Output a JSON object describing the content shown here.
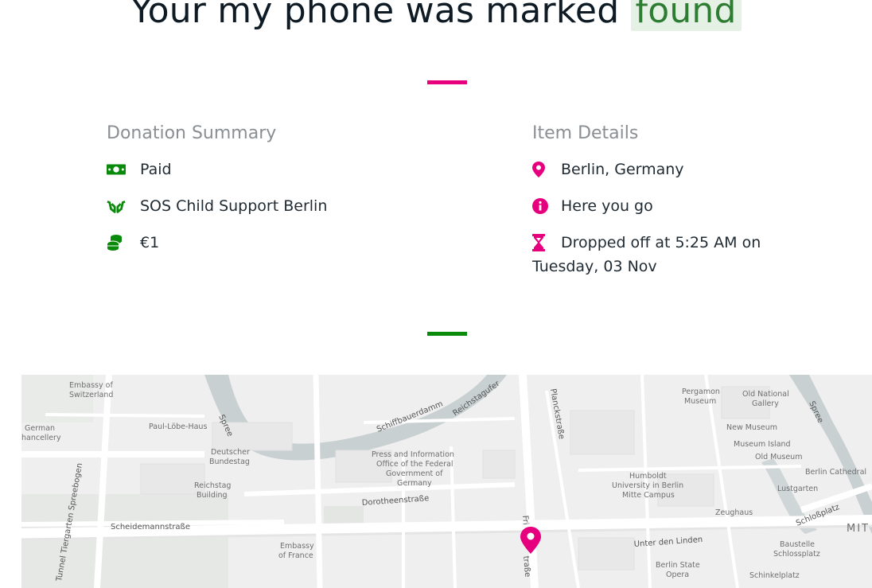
{
  "headline": {
    "prefix": "Your my phone was marked",
    "status": "found"
  },
  "colors": {
    "accent_pink": "#e6007e",
    "accent_green": "#0a8a0a",
    "found_bg": "#e6f1e6",
    "found_text": "#2e7d32"
  },
  "donation": {
    "title": "Donation Summary",
    "items": [
      {
        "icon": "money-bill-icon",
        "text": "Paid"
      },
      {
        "icon": "hands-holding-icon",
        "text": "SOS Child Support Berlin"
      },
      {
        "icon": "coins-icon",
        "text": "€1"
      }
    ]
  },
  "item": {
    "title": "Item Details",
    "items": [
      {
        "icon": "map-marker-icon",
        "text": "Berlin, Germany"
      },
      {
        "icon": "info-circle-icon",
        "text": "Here you go"
      },
      {
        "icon": "hourglass-icon",
        "text": "Dropped off at 5:25 AM on Tuesday, 03 Nov"
      }
    ]
  },
  "map": {
    "labels": {
      "embassy_switzerland": [
        "Embassy of",
        "Switzerland"
      ],
      "german_chancellery": [
        "German",
        "hancellery"
      ],
      "paul_loebe_haus": "Paul-Löbe-Haus",
      "deutscher_bundestag": [
        "Deutscher",
        "Bundestag"
      ],
      "reichstag": [
        "Reichstag",
        "Building"
      ],
      "press_office": [
        "Press and Information",
        "Office of the Federal",
        "Government of",
        "Germany"
      ],
      "embassy_france": [
        "Embassy",
        "of France"
      ],
      "pergamon": [
        "Pergamon",
        "Museum"
      ],
      "old_national_gallery": [
        "Old National",
        "Gallery"
      ],
      "new_museum": "New Museum",
      "museum_island": "Museum Island",
      "old_museum": "Old Museum",
      "humboldt": [
        "Humboldt",
        "University in Berlin",
        "Mitte Campus"
      ],
      "berlin_cathedral": "Berlin Cathedral",
      "lustgarten": "Lustgarten",
      "zeughaus": "Zeughaus",
      "berlin_state_opera": [
        "Berlin State",
        "Opera"
      ],
      "baustelle": [
        "Baustelle",
        "Schlossplatz"
      ],
      "schinkelplatz": "Schinkelplatz",
      "mitte": "MIT"
    },
    "streets": {
      "schiffbauerdamm": "Schiffbauerdamm",
      "reichstagufer": "Reichstagufer",
      "planckstrasse": "Planckstraße",
      "dorotheenstrasse": "Dorotheenstraße",
      "scheidemannstrasse": "Scheidemannstraße",
      "unter_den_linden": "Unter den Linden",
      "schlossplatz": "Schloßplatz",
      "spree": "Spree",
      "tunnel": "Tunnel Tiergarten Spreebogen",
      "friedrichstrasse_top": "Fri",
      "friedrichstrasse_bottom": "traße"
    }
  }
}
